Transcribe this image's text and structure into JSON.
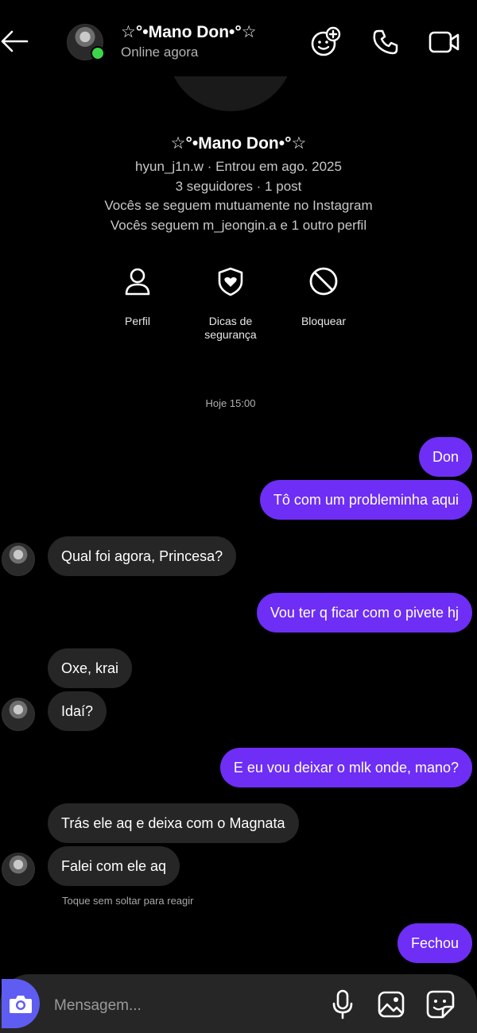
{
  "header": {
    "contact_name": "☆°•Mano Don•°☆",
    "status": "Online agora",
    "icons": [
      "back-arrow-icon",
      "effects-icon",
      "phone-icon",
      "video-icon"
    ]
  },
  "profile": {
    "name": "☆°•Mano Don•°☆",
    "line1": "hyun_j1n.w · Entrou em ago. 2025",
    "line2": "3 seguidores · 1 post",
    "line3": "Vocês se seguem mutuamente no Instagram",
    "line4": "Vocês seguem m_jeongin.a e 1 outro perfil",
    "actions": [
      {
        "label": "Perfil",
        "icon": "person-icon"
      },
      {
        "label": "Dicas de segurança",
        "icon": "shield-heart-icon"
      },
      {
        "label": "Bloquear",
        "icon": "block-icon"
      }
    ]
  },
  "timestamp": "Hoje 15:00",
  "messages": [
    {
      "from": "me",
      "text": "Don"
    },
    {
      "from": "me",
      "text": "Tô com um probleminha aqui"
    },
    {
      "from": "them",
      "text": "Qual foi agora, Princesa?"
    },
    {
      "from": "me",
      "text": "Vou ter q ficar com o pivete hj"
    },
    {
      "from": "them",
      "text": "Oxe, krai"
    },
    {
      "from": "them",
      "text": "Idaí?"
    },
    {
      "from": "me",
      "text": "E eu vou deixar o mlk onde, mano?"
    },
    {
      "from": "them",
      "text": "Trás ele aq e deixa com o Magnata"
    },
    {
      "from": "them",
      "text": "Falei com ele aq"
    },
    {
      "from": "me",
      "text": "Fechou"
    }
  ],
  "reaction_hint": "Toque sem soltar para reagir",
  "composer": {
    "placeholder": "Mensagem...",
    "icons": [
      "camera-icon",
      "microphone-icon",
      "gallery-icon",
      "sticker-icon"
    ]
  },
  "colors": {
    "sent_bubble": "#6e2ef5",
    "received_bubble": "#262626",
    "online": "#3dd64a",
    "camera_button": "#5f5cf2"
  }
}
